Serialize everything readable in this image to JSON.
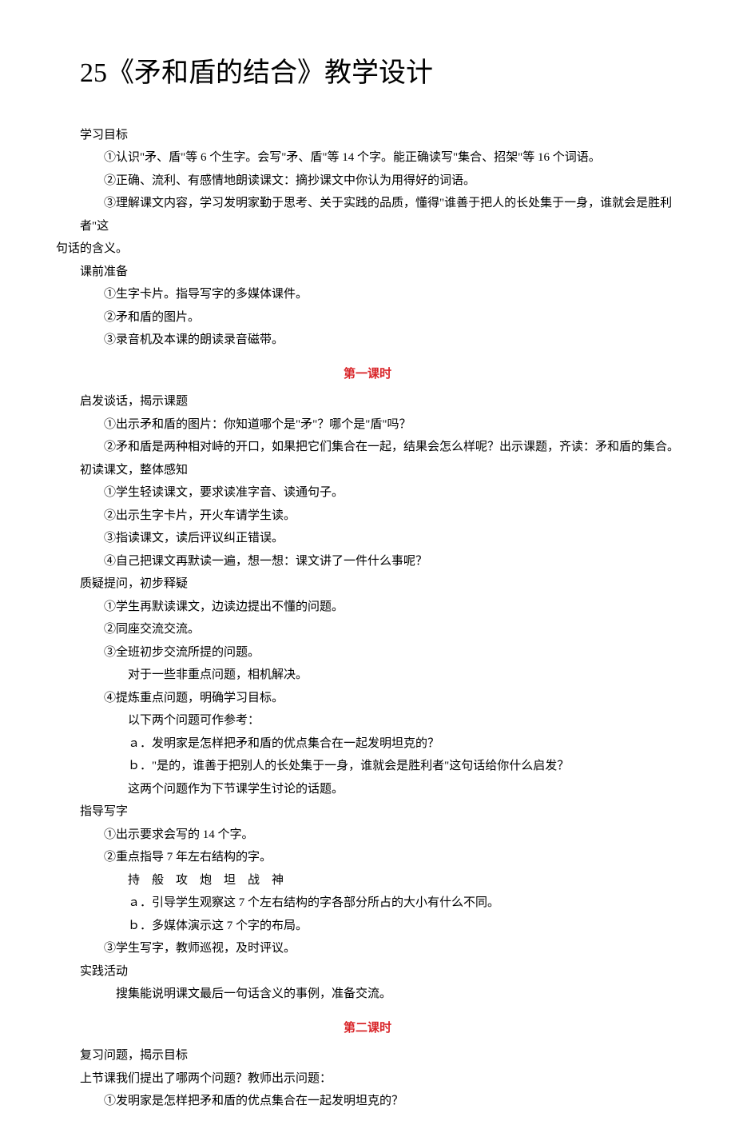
{
  "title": "25《矛和盾的结合》教学设计",
  "objectives_heading": "学习目标",
  "objectives": [
    "①认识\"矛、盾\"等 6 个生字。会写\"矛、盾\"等 14 个字。能正确读写\"集合、招架\"等 16 个词语。",
    "②正确、流利、有感情地朗读课文：摘抄课文中你认为用得好的词语。",
    "③理解课文内容，学习发明家勤于思考、关于实践的品质，懂得\"谁善于把人的长处集于一身，谁就会是胜利者\"这"
  ],
  "objectives_tail": "句话的含义。",
  "prep_heading": "课前准备",
  "prep": [
    "①生字卡片。指导写字的多媒体课件。",
    "②矛和盾的图片。",
    "③录音机及本课的朗读录音磁带。"
  ],
  "lesson1_title": "第一课时",
  "l1": {
    "s1_heading": "启发谈话，揭示课题",
    "s1_items": [
      "①出示矛和盾的图片：你知道哪个是\"矛\"？哪个是\"盾\"吗？",
      "②矛和盾是两种相对峙的开口，如果把它们集合在一起，结果会怎么样呢？出示课题，齐读：矛和盾的集合。"
    ],
    "s2_heading": "初读课文，整体感知",
    "s2_items": [
      "①学生轻读课文，要求读准字音、读通句子。",
      "②出示生字卡片，开火车请学生读。",
      "③指读课文，读后评议纠正错误。",
      "④自己把课文再默读一遍，想一想：课文讲了一件什么事呢？"
    ],
    "s3_heading": "质疑提问，初步释疑",
    "s3_items": [
      "①学生再默读课文，边读边提出不懂的问题。",
      "②同座交流交流。",
      "③全班初步交流所提的问题。"
    ],
    "s3_sub1": "对于一些非重点问题，相机解决。",
    "s3_item4": "④提炼重点问题，明确学习目标。",
    "s3_sub2": "以下两个问题可作参考：",
    "s3_a": "ａ．发明家是怎样把矛和盾的优点集合在一起发明坦克的？",
    "s3_b": "ｂ．\"是的，谁善于把别人的长处集于一身，谁就会是胜利者\"这句话给你什么启发？",
    "s3_sub3": "这两个问题作为下节课学生讨论的话题。",
    "s4_heading": "指导写字",
    "s4_items": [
      "①出示要求会写的 14 个字。",
      "②重点指导 7 年左右结构的字。"
    ],
    "s4_chars": "持　般　攻　炮　坦　战　神",
    "s4_a": "ａ．引导学生观察这 7 个左右结构的字各部分所占的大小有什么不同。",
    "s4_b": "ｂ．多媒体演示这 7 个字的布局。",
    "s4_item3": "③学生写字，教师巡视，及时评议。",
    "s5_heading": "实践活动",
    "s5_item": "搜集能说明课文最后一句话含义的事例，准备交流。"
  },
  "lesson2_title": "第二课时",
  "l2": {
    "s1_heading": "复习问题，揭示目标",
    "s1_line": "上节课我们提出了哪两个问题？教师出示问题：",
    "s1_item": "①发明家是怎样把矛和盾的优点集合在一起发明坦克的？"
  }
}
